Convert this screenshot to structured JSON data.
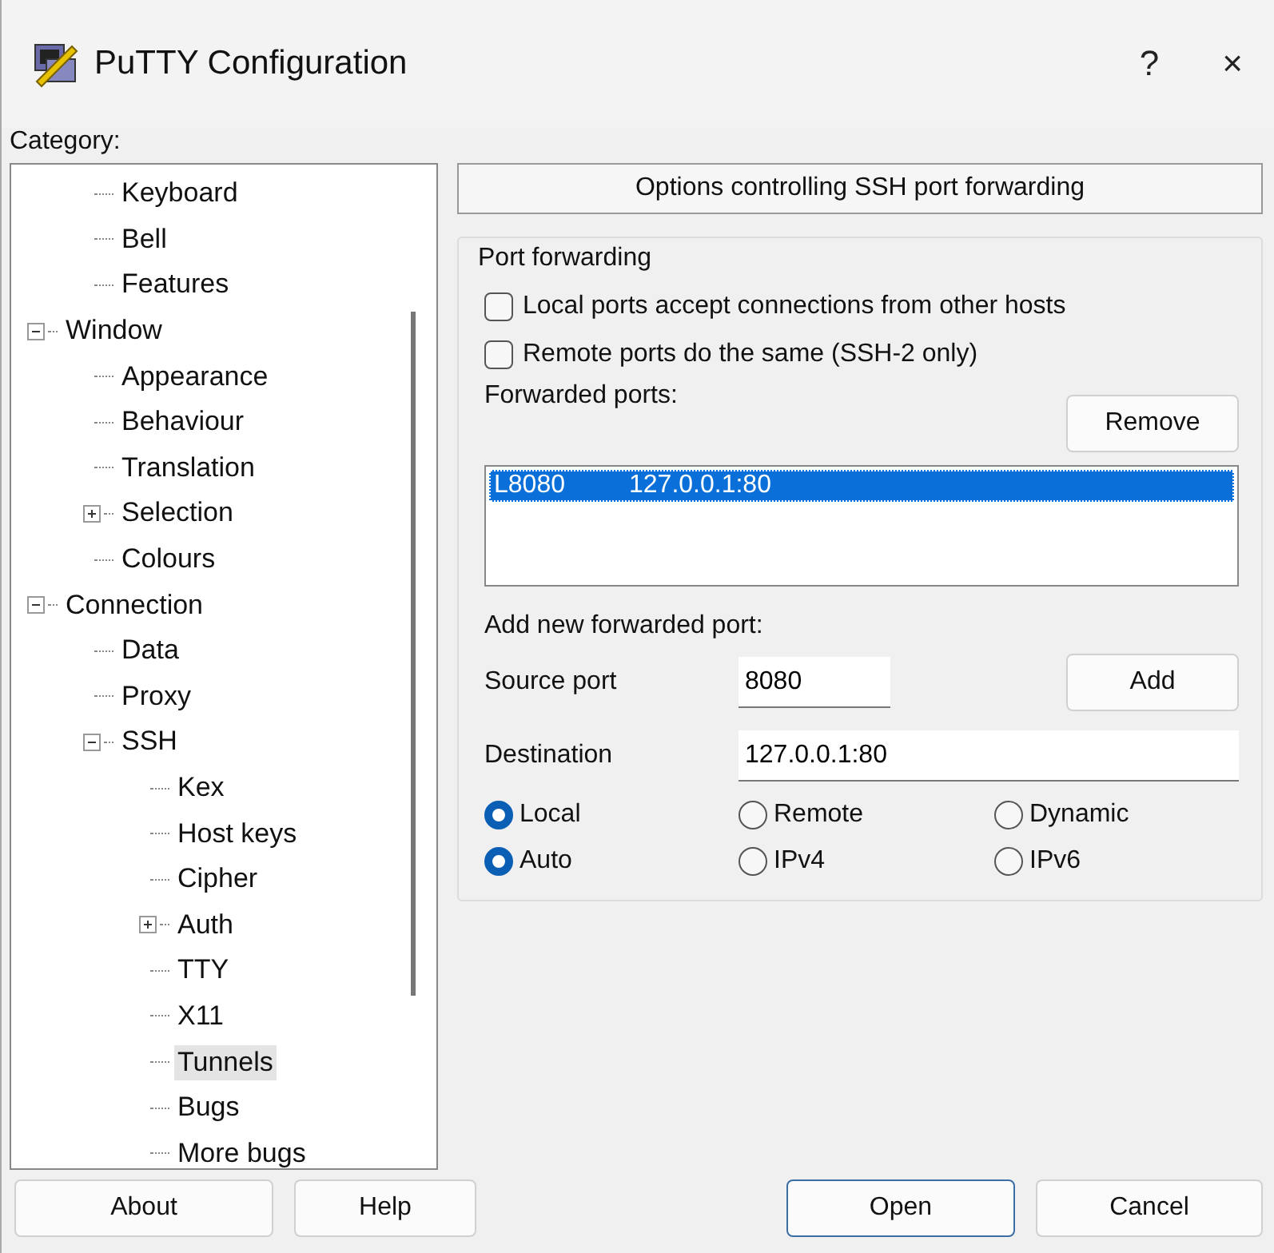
{
  "window": {
    "title": "PuTTY Configuration",
    "help": "?",
    "close": "×"
  },
  "category": {
    "label": "Category:",
    "items": [
      {
        "children": [
          {
            "label": "Keyboard",
            "selected": false
          },
          {
            "label": "Bell",
            "selected": false
          },
          {
            "label": "Features",
            "selected": false
          }
        ]
      },
      {
        "label": "Window",
        "selected": false,
        "expanded": true,
        "children": [
          {
            "label": "Appearance",
            "selected": false
          },
          {
            "label": "Behaviour",
            "selected": false
          },
          {
            "label": "Translation",
            "selected": false
          },
          {
            "label": "Selection",
            "selected": false,
            "expanded": false
          },
          {
            "label": "Colours",
            "selected": false
          }
        ]
      },
      {
        "label": "Connection",
        "selected": false,
        "expanded": true,
        "children": [
          {
            "label": "Data",
            "selected": false
          },
          {
            "label": "Proxy",
            "selected": false
          },
          {
            "label": "SSH",
            "selected": false,
            "expanded": true,
            "children": [
              {
                "label": "Kex",
                "selected": false
              },
              {
                "label": "Host keys",
                "selected": false
              },
              {
                "label": "Cipher",
                "selected": false
              },
              {
                "label": "Auth",
                "selected": false,
                "expanded": false
              },
              {
                "label": "TTY",
                "selected": false
              },
              {
                "label": "X11",
                "selected": false
              },
              {
                "label": "Tunnels",
                "selected": true
              },
              {
                "label": "Bugs",
                "selected": false
              },
              {
                "label": "More bugs",
                "selected": false
              }
            ]
          }
        ]
      }
    ]
  },
  "panel": {
    "header": "Options controlling SSH port forwarding",
    "group": {
      "legend": "Port forwarding",
      "checkboxes": [
        {
          "label": "Local ports accept connections from other hosts",
          "checked": false
        },
        {
          "label": "Remote ports do the same (SSH-2 only)",
          "checked": false
        }
      ],
      "forwarded_label": "Forwarded ports:",
      "remove_button": "Remove",
      "forwarded_list": [
        {
          "source": "L8080",
          "destination": "127.0.0.1:80",
          "selected": true
        }
      ],
      "add_label": "Add new forwarded port:",
      "source_port": {
        "label": "Source port",
        "value": "8080"
      },
      "add_button": "Add",
      "destination": {
        "label": "Destination",
        "value": "127.0.0.1:80"
      },
      "radio_rows": [
        [
          {
            "label": "Local",
            "selected": true
          },
          {
            "label": "Remote",
            "selected": false
          },
          {
            "label": "Dynamic",
            "selected": false
          }
        ],
        [
          {
            "label": "Auto",
            "selected": true
          },
          {
            "label": "IPv4",
            "selected": false
          },
          {
            "label": "IPv6",
            "selected": false
          }
        ]
      ]
    }
  },
  "buttons": [
    {
      "label": "About",
      "default": false
    },
    {
      "label": "Help",
      "default": false
    },
    {
      "label": "Open",
      "default": true
    },
    {
      "label": "Cancel",
      "default": false
    }
  ]
}
